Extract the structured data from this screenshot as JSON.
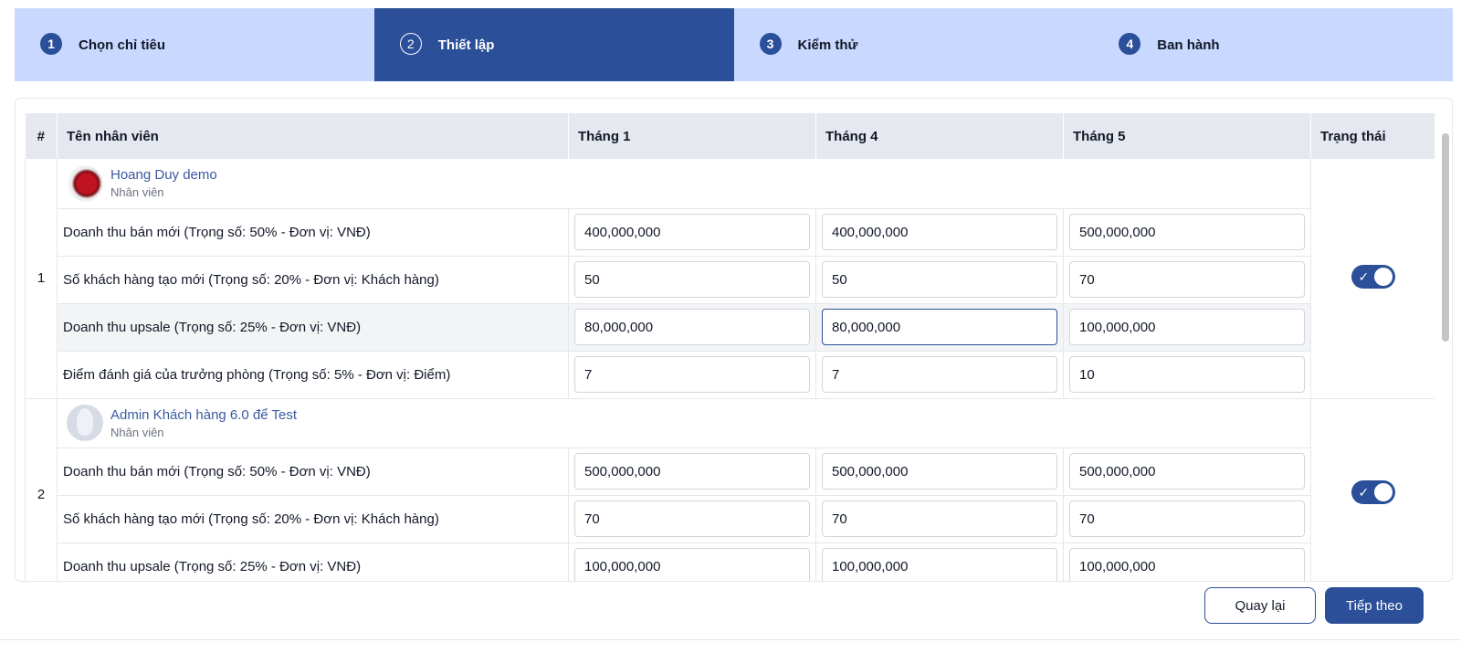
{
  "steps": [
    {
      "num": "1",
      "label": "Chọn chỉ tiêu"
    },
    {
      "num": "2",
      "label": "Thiết lập"
    },
    {
      "num": "3",
      "label": "Kiểm thử"
    },
    {
      "num": "4",
      "label": "Ban hành"
    }
  ],
  "active_step": 2,
  "table": {
    "headers": {
      "index": "#",
      "name": "Tên nhân viên",
      "m1": "Tháng 1",
      "m4": "Tháng 4",
      "m5": "Tháng 5",
      "status": "Trạng thái"
    }
  },
  "employees": [
    {
      "index": "1",
      "name": "Hoang Duy demo",
      "role": "Nhân viên",
      "status_on": true,
      "metrics": [
        {
          "label": "Doanh thu bán mới (Trọng số: 50% - Đơn vị: VNĐ)",
          "m1": "400,000,000",
          "m4": "400,000,000",
          "m5": "500,000,000"
        },
        {
          "label": "Số khách hàng tạo mới (Trọng số: 20% - Đơn vị: Khách hàng)",
          "m1": "50",
          "m4": "50",
          "m5": "70"
        },
        {
          "label": "Doanh thu upsale (Trọng số: 25% - Đơn vị: VNĐ)",
          "m1": "80,000,000",
          "m4": "80,000,000",
          "m5": "100,000,000"
        },
        {
          "label": "Điểm đánh giá của trưởng phòng (Trọng số: 5% - Đơn vị: Điểm)",
          "m1": "7",
          "m4": "7",
          "m5": "10"
        }
      ]
    },
    {
      "index": "2",
      "name": "Admin Khách hàng 6.0 để Test",
      "role": "Nhân viên",
      "status_on": true,
      "metrics": [
        {
          "label": "Doanh thu bán mới (Trọng số: 50% - Đơn vị: VNĐ)",
          "m1": "500,000,000",
          "m4": "500,000,000",
          "m5": "500,000,000"
        },
        {
          "label": "Số khách hàng tạo mới (Trọng số: 20% - Đơn vị: Khách hàng)",
          "m1": "70",
          "m4": "70",
          "m5": "70"
        },
        {
          "label": "Doanh thu upsale (Trọng số: 25% - Đơn vị: VNĐ)",
          "m1": "100,000,000",
          "m4": "100,000,000",
          "m5": "100,000,000"
        }
      ]
    }
  ],
  "footer": {
    "back_label": "Quay lại",
    "next_label": "Tiếp theo"
  },
  "colors": {
    "primary": "#2b4f98",
    "stepper_bg": "#c9d8ff",
    "header_bg": "#e5e8ee"
  }
}
